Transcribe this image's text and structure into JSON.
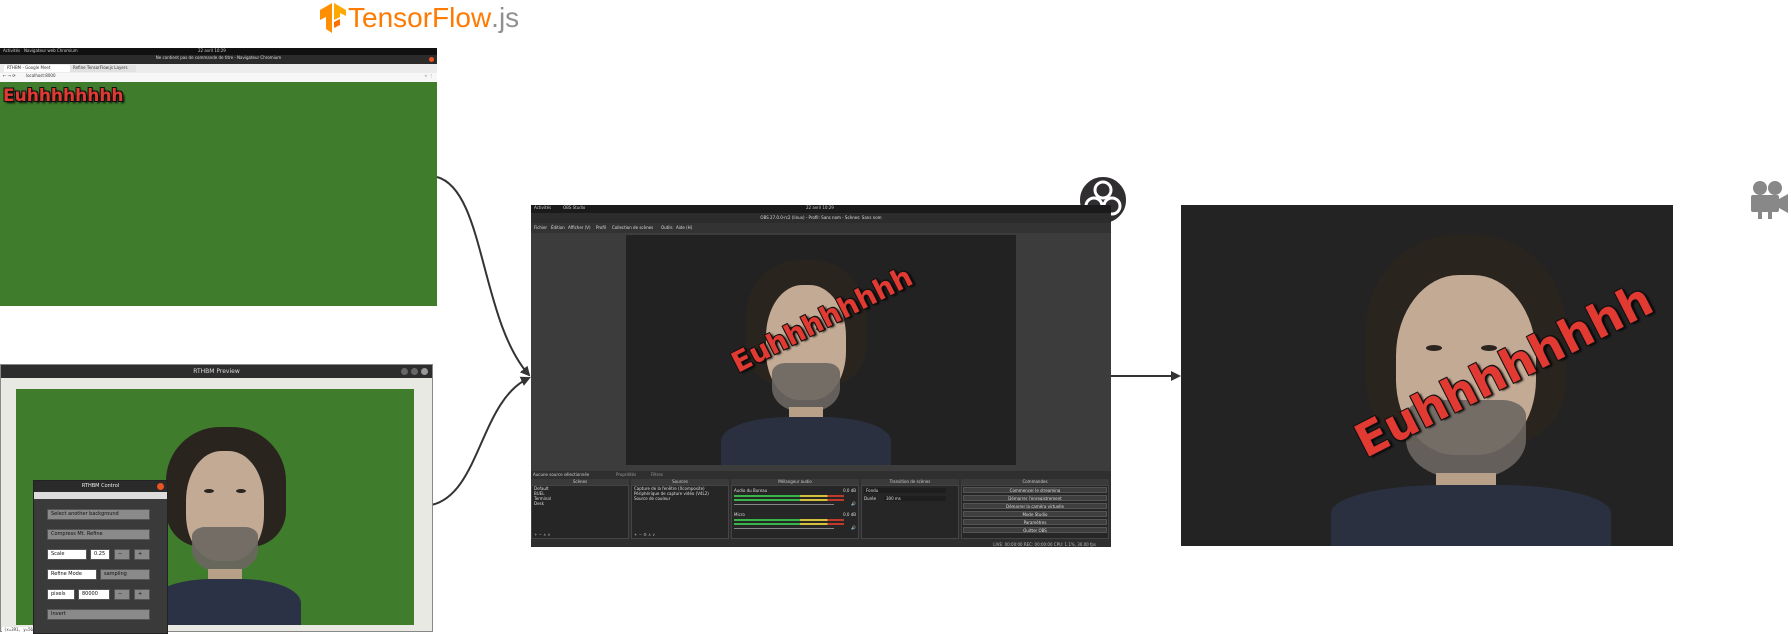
{
  "logo": {
    "brand": "TensorFlow",
    "suffix": ".js",
    "brand_color": "#ff7a00",
    "suffix_color": "#909090"
  },
  "browser": {
    "topbar_left": "Activités",
    "topbar_app": "Navigateur web Chromium",
    "topbar_clock": "22 avril 10:29",
    "title": "Ne contient pas de commande de titre - Navigateur Chromium",
    "tabs": [
      "RTHBM - Google Meet",
      "Refine TensorFlow.js Layers"
    ],
    "url": "localhost:8000",
    "overlay_text": "Euhhhhhhhh"
  },
  "preview": {
    "title": "RTHBM Preview",
    "status": "(x=391, y=56)"
  },
  "control": {
    "title": "RTHBM Control",
    "select_background": "Select another background",
    "compress_button": "Compress Mt. Refine",
    "scale_label": "Scale",
    "scale_value": "0.25",
    "minus": "−",
    "plus": "+",
    "refine_mode_label": "Refine Mode",
    "refine_mode_value": "sampling",
    "pixels_label": "pixels",
    "pixels_value": "80000",
    "invert_button": "Invert"
  },
  "obs": {
    "topbar_left": "Activités",
    "topbar_app": "OBS Studio",
    "topbar_clock": "22 avril 10:29",
    "title": "OBS 27.0.0-rc2 (linux) - Profil: Sans nom - Scènes: Sans nom",
    "menu": [
      "Fichier",
      "Édition",
      "Afficher (V)",
      "Profil",
      "Collection de scènes",
      "Outils",
      "Aide (H)"
    ],
    "source_bar": "Aucune source sélectionnée",
    "properties_label": "Propriétés",
    "filters_label": "Filtres",
    "overlay_text": "Euhhhhhhhh",
    "docks": {
      "scenes": {
        "title": "Scènes",
        "items": [
          "Default",
          "BUEL",
          "Terminal",
          "Desk"
        ]
      },
      "sources": {
        "title": "Sources",
        "items": [
          "Capture de la fenêtre (Xcomposite)",
          "Périphérique de capture vidéo (V4L2)",
          "Source de couleur"
        ]
      },
      "mixer": {
        "title": "Mélangeur audio",
        "channels": [
          {
            "name": "Audio du Bureau",
            "level": "0.0 dB"
          },
          {
            "name": "Micro",
            "level": "0.0 dB"
          }
        ]
      },
      "transitions": {
        "title": "Transition de scènes",
        "type": "Fondu",
        "duration_label": "Durée",
        "duration_value": "300 ms"
      },
      "controls": {
        "title": "Commandes",
        "buttons": [
          "Commencer le streaming",
          "Démarrer l'enregistrement",
          "Démarrer la caméra virtuelle",
          "Mode Studio",
          "Paramètres",
          "Quitter OBS"
        ]
      }
    },
    "status": "LIVE: 00:00:00   REC: 00:00:00   CPU: 1.1%, 30.00 fps"
  },
  "output": {
    "overlay_text": "Euhhhhhhhh"
  },
  "icons": {
    "obs": "obs-logo-icon",
    "camera": "video-camera-icon",
    "tensorflow": "tensorflow-logo-icon"
  }
}
